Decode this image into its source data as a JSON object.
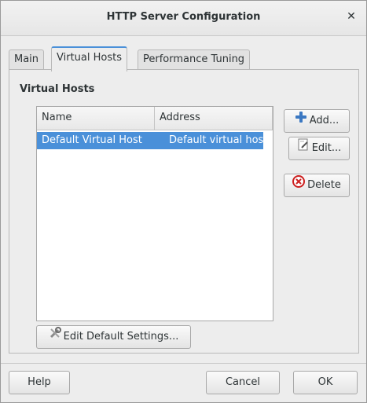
{
  "window": {
    "title": "HTTP Server Configuration",
    "close_icon": "close-icon"
  },
  "tabs": [
    {
      "label": "Main"
    },
    {
      "label": "Virtual Hosts"
    },
    {
      "label": "Performance Tuning"
    }
  ],
  "virtual_hosts": {
    "section_label": "Virtual Hosts",
    "columns": [
      "Name",
      "Address"
    ],
    "rows": [
      {
        "name": "Default Virtual Host",
        "address": "Default virtual host",
        "selected": true
      }
    ]
  },
  "side_buttons": {
    "add": {
      "label": "Add...",
      "icon": "add-plus-icon"
    },
    "edit": {
      "label": "Edit...",
      "icon": "edit-document-icon"
    },
    "delete": {
      "label": "Delete",
      "icon": "delete-x-icon"
    }
  },
  "edit_defaults": {
    "label": "Edit Default Settings...",
    "icon": "tools-icon"
  },
  "footer": {
    "help": "Help",
    "cancel": "Cancel",
    "ok": "OK"
  },
  "colors": {
    "accent": "#4a90d9",
    "selection": "#4a90d9",
    "delete_red": "#cc1f1f",
    "add_blue": "#3b78c2"
  }
}
